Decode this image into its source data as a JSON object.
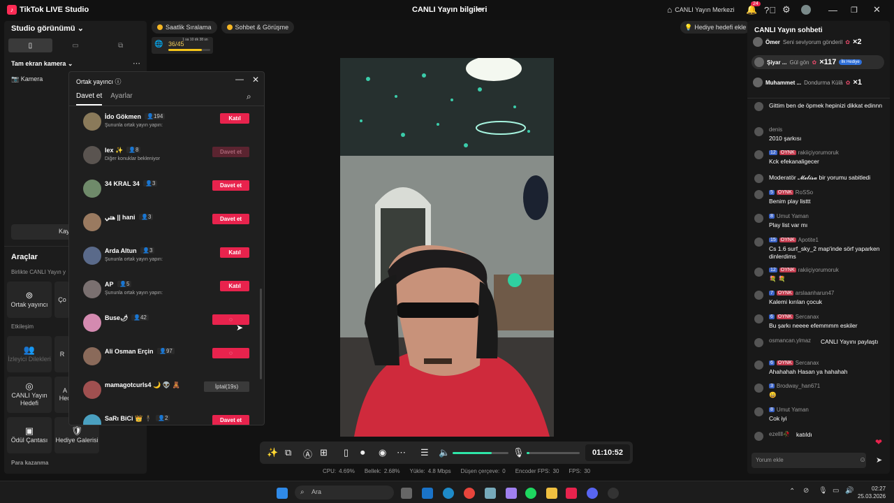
{
  "titlebar": {
    "app_title": "TikTok LIVE Studio",
    "center_title": "CANLI Yayın bilgileri",
    "live_center": "CANLI Yayın Merkezi",
    "notif_count": "24"
  },
  "left_panel": {
    "studio_view": "Studio görünümü",
    "fullscreen_camera": "Tam ekran kamera",
    "camera": "Kamera",
    "add_label": "Kay",
    "tools": "Araçlar",
    "live_together": "Birlikte CANLI Yayın y",
    "cohost": "Ortak yayıncı",
    "cohost_partial": "Ço",
    "interaction": "Etkileşim",
    "viewer_requests": "İzleyici Dilekleri",
    "r_partial": "R",
    "live_goal": "CANLI Yayın Hedefi",
    "a_partial": "A",
    "hed_partial": "Hed",
    "prize_box": "Ödül Çantası",
    "gift_gallery": "Hediye Galerisi",
    "earn_money": "Para kazanma"
  },
  "chips": {
    "hourly_rank": "Saatlik Sıralama",
    "chat_meet": "Sohbet & Görüşme",
    "gift_goal": "Hediye hedefi ekle",
    "rank_value": "36/45",
    "rank_time": "1 sa 10 dk 38 sn",
    "rank_progress": 0.8
  },
  "modal": {
    "title": "Ortak yayıncı",
    "tab_invite": "Davet et",
    "tab_settings": "Ayarlar",
    "hosts": [
      {
        "name": "İdo Gökmen",
        "count": "194",
        "sub": "Şununla ortak yayın yapın:",
        "button": "Katıl",
        "style": "red",
        "color": "#8a7a5a"
      },
      {
        "name": "lex ✨",
        "count": "8",
        "sub": "Diğer konuklar bekleniyor",
        "button": "Davet et",
        "style": "dim",
        "color": "#5a5450"
      },
      {
        "name": "34 KRAL 34",
        "count": "3",
        "sub": "",
        "button": "Davet et",
        "style": "red",
        "color": "#6f8a6a"
      },
      {
        "name": "هتي || hani",
        "count": "3",
        "sub": "",
        "button": "Davet et",
        "style": "red",
        "color": "#9a7a60"
      },
      {
        "name": "Arda Altun",
        "count": "3",
        "sub": "Şununla ortak yayın yapın:",
        "button": "Katıl",
        "style": "red",
        "color": "#5a6a8a"
      },
      {
        "name": "AP",
        "count": "5",
        "sub": "Şununla ortak yayın yapın:",
        "button": "Katıl",
        "style": "red",
        "color": "#7a7070"
      },
      {
        "name": "Buse🌶",
        "count": "42",
        "sub": "",
        "button": "◌",
        "style": "red",
        "color": "#d48ab0"
      },
      {
        "name": "Ali Osman Erçin",
        "count": "97",
        "sub": "",
        "button": "◌",
        "style": "red",
        "color": "#8a6a5a"
      },
      {
        "name": "mamagotcurls4 🌙 👽 🧸",
        "count": "",
        "sub": "",
        "button": "İptal(19s)",
        "style": "gray",
        "color": "#a05050"
      },
      {
        "name": "SaRı BiCi 👑 🕴",
        "count": "2",
        "sub": "",
        "button": "Davet et",
        "style": "red",
        "color": "#4aa0c0"
      }
    ]
  },
  "bottom_bar": {
    "timer": "01:10:52",
    "mic_level": 0.05,
    "volume_level": 0.7
  },
  "stats": {
    "cpu_label": "CPU:",
    "cpu": "4.69%",
    "mem_label": "Bellek:",
    "mem": "2.68%",
    "upload_label": "Yükle:",
    "upload": "4.8 Mbps",
    "dropped_label": "Düşen çerçeve:",
    "dropped": "0",
    "encoder_label": "Encoder FPS:",
    "encoder": "30",
    "fps_label": "FPS:",
    "fps": "30"
  },
  "chat": {
    "title": "CANLI Yayın sohbeti",
    "gifts": [
      {
        "name": "Ömer",
        "msg": "Seni seviyorum gönderil",
        "x": "×2"
      },
      {
        "name": "Şiyar ...",
        "msg": "Gül gön",
        "x": "×117",
        "tag": "İlk Hediye"
      },
      {
        "name": "Muhammet ...",
        "msg": "Dondurma Külâ",
        "x": "×1"
      }
    ],
    "messages": [
      {
        "meta": "",
        "text": "Gittim ben de öpmek hepinizi dikkat edinnn"
      },
      {
        "meta": "denis",
        "text": "2010 şarkısı"
      },
      {
        "lv": "12",
        "oynk": "OYNK",
        "meta": "rakiiçiyorumoruk",
        "text": "Kck efekanaligecer"
      },
      {
        "meta": "",
        "text": "Moderatör 𝓜𝓮𝓵𝓲𝓼𝓪 bir yorumu sabitledi"
      },
      {
        "lv": "5",
        "oynk": "OYNK",
        "meta": "RoSSo",
        "text": "Benim play listtt"
      },
      {
        "lv": "8",
        "meta": "Umut Yaman",
        "text": "Play list var mı"
      },
      {
        "lv": "15",
        "oynk": "OYNK",
        "meta": "Apotite1",
        "text": "Cs 1.6 surf_sky_2 map'inde sörf yaparken dinlerdims"
      },
      {
        "lv": "12",
        "oynk": "OYNK",
        "meta": "rakiiçiyorumoruk",
        "text": "💐 💐"
      },
      {
        "lv": "7",
        "oynk": "OYNK",
        "meta": "arslaanharun47",
        "text": "Kalemi kırılan çocuk"
      },
      {
        "lv": "6",
        "oynk": "OYNK",
        "meta": "Sercanax",
        "text": "Bu şarkı neeee efemmmm eskiler"
      },
      {
        "meta": "osmancan.ylmaz",
        "text": "CANLI Yayını paylaştı"
      },
      {
        "lv": "6",
        "oynk": "OYNK",
        "meta": "Sercanax",
        "text": "Ahahahah Hasan ya hahahah"
      },
      {
        "lv": "3",
        "meta": "Brodway_han671",
        "text": "😄"
      },
      {
        "lv": "8",
        "meta": "Umut Yaman",
        "text": "Cok iyi"
      },
      {
        "meta": "ezellll🥀",
        "text": "katıldı"
      }
    ],
    "input_placeholder": "Yorum ekle"
  },
  "taskbar": {
    "search": "Ara",
    "time": "02:27",
    "date": "25.03.2026"
  }
}
